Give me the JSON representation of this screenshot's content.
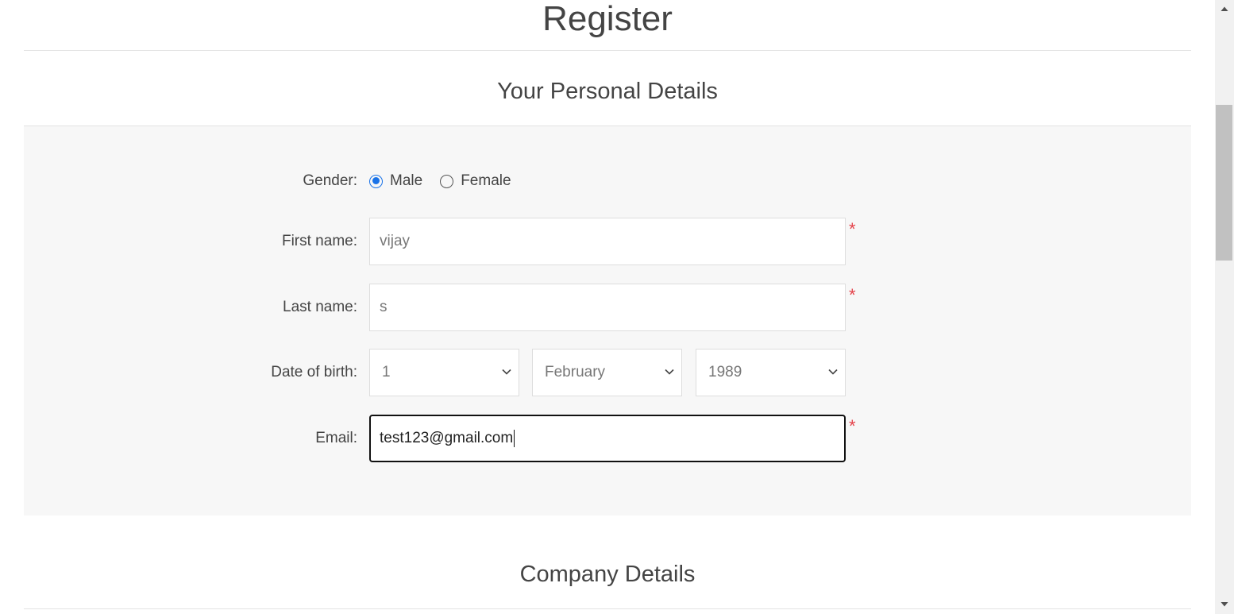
{
  "page": {
    "title": "Register"
  },
  "personal": {
    "title": "Your Personal Details",
    "gender": {
      "label": "Gender:",
      "options": [
        "Male",
        "Female"
      ],
      "selected": "Male"
    },
    "first_name": {
      "label": "First name:",
      "value": "vijay"
    },
    "last_name": {
      "label": "Last name:",
      "value": "s"
    },
    "dob": {
      "label": "Date of birth:",
      "day": "1",
      "month": "February",
      "year": "1989"
    },
    "email": {
      "label": "Email:",
      "value": "test123@gmail.com"
    },
    "required_mark": "*"
  },
  "company": {
    "title": "Company Details"
  },
  "colors": {
    "accent": "#1a73e8",
    "required": "#e4434b",
    "panel_bg": "#f7f7f7"
  },
  "icons": [
    "chevron-down-icon",
    "scroll-up-arrow-icon",
    "scroll-down-arrow-icon"
  ]
}
